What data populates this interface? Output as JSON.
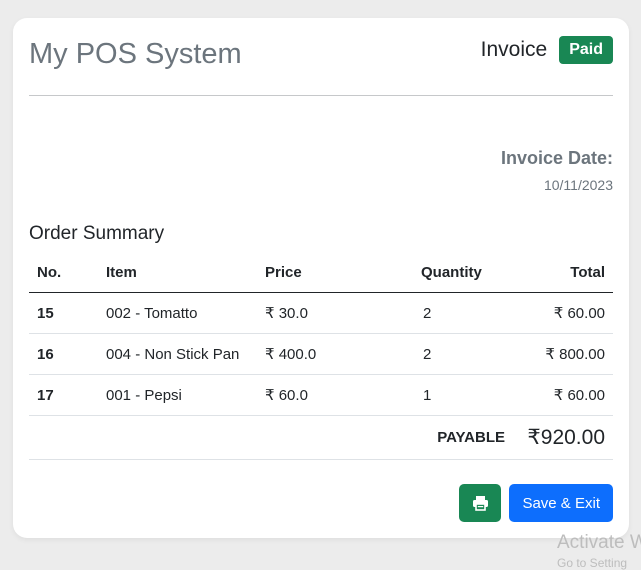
{
  "header": {
    "app_title": "My POS System",
    "invoice_label": "Invoice",
    "status": "Paid",
    "status_color": "#198754"
  },
  "invoice_date": {
    "label": "Invoice Date:",
    "value": "10/11/2023"
  },
  "order_summary": {
    "title": "Order Summary",
    "columns": [
      "No.",
      "Item",
      "Price",
      "Quantity",
      "Total"
    ],
    "rows": [
      {
        "no": "15",
        "item": "002 - Tomatto",
        "price": "₹ 30.0",
        "quantity": "2",
        "total": "₹ 60.00"
      },
      {
        "no": "16",
        "item": "004 - Non Stick Pan",
        "price": "₹ 400.0",
        "quantity": "2",
        "total": "₹ 800.00"
      },
      {
        "no": "17",
        "item": "001 - Pepsi",
        "price": "₹ 60.0",
        "quantity": "1",
        "total": "₹ 60.00"
      }
    ],
    "payable_label": "PAYABLE",
    "payable_amount": "₹920.00"
  },
  "actions": {
    "print_icon": "printer-icon",
    "print_color": "#198754",
    "save_label": "Save & Exit",
    "save_color": "#0d6efd"
  },
  "watermark": {
    "line1": "Activate W",
    "line2": "Go to Setting"
  }
}
